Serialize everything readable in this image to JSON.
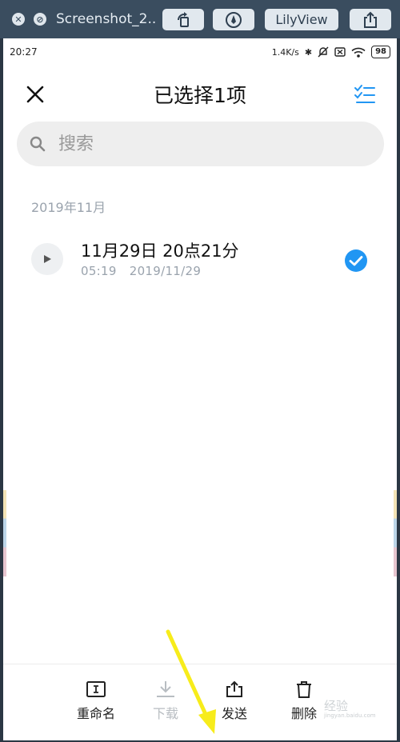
{
  "viewer": {
    "title": "Screenshot_2...",
    "lilyview_label": "LilyView"
  },
  "status_bar": {
    "time": "20:27",
    "speed": "1.4K/s",
    "battery": "98"
  },
  "header": {
    "title": "已选择1项"
  },
  "search": {
    "placeholder": "搜索"
  },
  "list": {
    "group_label": "2019年11月",
    "items": [
      {
        "title": "11月29日 20点21分",
        "duration": "05:19",
        "date": "2019/11/29",
        "selected": true
      }
    ]
  },
  "bottom_bar": {
    "rename": "重命名",
    "download": "下载",
    "send": "发送",
    "delete": "删除"
  },
  "watermark": {
    "text": "经验",
    "url": "jingyan.baidu.com"
  },
  "colors": {
    "accent": "#2196f3",
    "annotation_arrow": "#f7ec1b"
  }
}
